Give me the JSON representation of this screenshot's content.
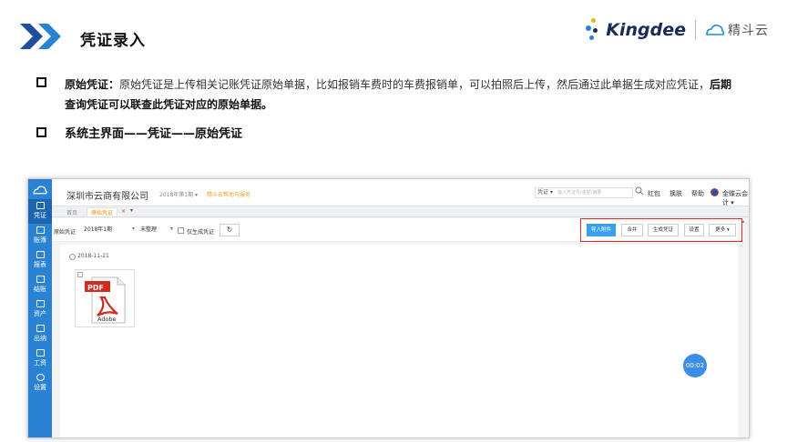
{
  "slide": {
    "title": "凭证录入",
    "brand_left": "Kingdee",
    "brand_right": "精斗云",
    "bullet1_label": "原始凭证：",
    "bullet1_text": "原始凭证是上传相关记账凭证原始单据，比如报销车费时的车费报销单，可以拍照后上传，然后通过此单据生成对应凭证，",
    "bullet1_bold_end": "后期查询凭证可以联查此凭证对应的原始单据。",
    "bullet2_text": "系统主界面——凭证——原始凭证"
  },
  "app": {
    "nav": [
      {
        "label": "凭证",
        "icon": "voucher-icon"
      },
      {
        "label": "账簿",
        "icon": "ledger-icon"
      },
      {
        "label": "报表",
        "icon": "report-icon"
      },
      {
        "label": "结账",
        "icon": "closing-icon"
      },
      {
        "label": "资产",
        "icon": "asset-icon"
      },
      {
        "label": "出纳",
        "icon": "cashier-icon"
      },
      {
        "label": "工资",
        "icon": "salary-icon"
      },
      {
        "label": "设置",
        "icon": "settings-icon"
      }
    ],
    "top": {
      "company": "深圳市云商有限公司",
      "period": "2018年第1期 ▾",
      "notice": "精斗云帮助与服务",
      "search_prefix": "凭证 ▾",
      "search_placeholder": "输入凭证号/金额/摘要",
      "links": [
        "红包",
        "换肤",
        "帮助"
      ],
      "user": "金蝶云会计 ▾"
    },
    "tabs": {
      "home": "首页",
      "active": "原始凭证",
      "close": "×",
      "more": "▾"
    },
    "toolbar": {
      "label": "原始凭证",
      "period_select": "2018年1期",
      "status_select": "未整理",
      "checkbox_label": "仅生成凭证",
      "refresh_glyph": "↻",
      "actions": [
        "导入附件",
        "合并",
        "生成凭证",
        "设置",
        "更多 ▾"
      ]
    },
    "content": {
      "date": "2018-11-21",
      "pdf_label": "PDF",
      "adobe_label": "Adobe",
      "timer": "00:02"
    }
  },
  "colors": {
    "nav_blue": "#2a82d4",
    "accent_orange": "#f08a00",
    "primary_button": "#3aa0ee",
    "highlight_red": "#e52828",
    "pdf_red": "#d42a1f"
  }
}
